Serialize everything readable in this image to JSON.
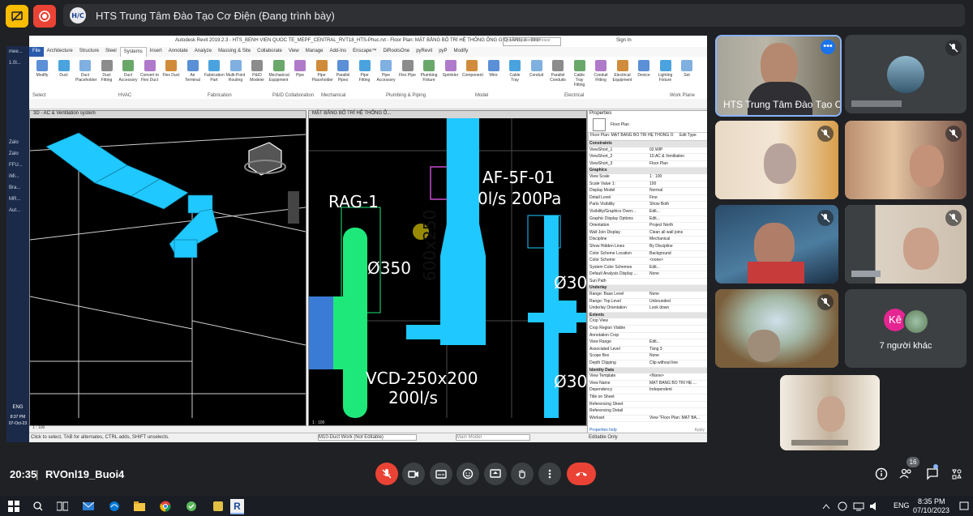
{
  "app": {
    "presenter_title": "HTS Trung Tâm Đào Tạo Cơ Điện (Đang trình bày)",
    "logo_text": "H/C",
    "time": "20:35",
    "meeting_code": "RVOnl19_Buoi4",
    "people_count": "16",
    "others_label": "7 người khác",
    "others_avatar": "Kê",
    "presenter_name": "HTS Trung Tâm Đào Tạo Cơ Đ..."
  },
  "revit": {
    "title": "Autodesk Revit 2019.2.3 - HTS_BENH VIEN QUOC TE_MEPF_CENTRAL_RVT18_HTS-Phuc.rvt - Floor Plan: MẶT BẰNG BỐ TRÍ HỆ THỐNG ỐNG GIÓ TẦNG 3 - WIP",
    "search_placeholder": "Type a keyword or phrase",
    "sign_in": "Sign In",
    "tabs": [
      "File",
      "Architecture",
      "Structure",
      "Steel",
      "Systems",
      "Insert",
      "Annotate",
      "Analyze",
      "Massing & Site",
      "Collaborate",
      "View",
      "Manage",
      "Add-Ins",
      "Enscape™",
      "DiRootsOne",
      "pyRevit",
      "pyP",
      "Modify"
    ],
    "ribbon_items": [
      "Modify",
      "Duct",
      "Duct Placeholder",
      "Duct Fitting",
      "Duct Accessory",
      "Convert to Flex Duct",
      "Flex Duct",
      "Air Terminal",
      "Fabrication Part",
      "Multi-Point Routing",
      "P&ID Modeler",
      "Mechanical Equipment",
      "Pipe",
      "Pipe Placeholder",
      "Parallel Pipes",
      "Pipe Fitting",
      "Pipe Accessory",
      "Flex Pipe",
      "Plumbing Fixture",
      "Sprinkler",
      "Component",
      "Wire",
      "Cable Tray",
      "Conduit",
      "Parallel Conduits",
      "Cable Tray Fitting",
      "Conduit Fitting",
      "Electrical Equipment",
      "Device",
      "Lighting Fixture",
      "Set"
    ],
    "ribbon_groups": [
      "Select",
      "HVAC",
      "Fabrication",
      "P&ID Collaboration",
      "Mechanical",
      "Plumbing & Piping",
      "Model",
      "Electrical",
      "Work Plane"
    ],
    "view3d_title": "3D - AC & Ventilation system",
    "viewplan_title": "MẶT BẰNG BỐ TRÍ HỆ THỐNG Ố...",
    "scale1": "1 : 100",
    "scale2": "1 : 100",
    "status_text": "Click to select, TAB for alternates, CTRL adds, SHIFT unselects.",
    "workset": "M10-Duct Work (Not Editable)",
    "main_model": "Main Model",
    "editable_only": "Editable Only",
    "cad_labels": {
      "rag": "RAG-1",
      "d350": "Ø350",
      "af": "AF-5F-01",
      "flow1": "0l/s  200Pa",
      "dim": "600x250",
      "d30a": "Ø30",
      "d30b": "Ø30",
      "vcd": "VCD-250x200",
      "flow2": "200l/s"
    }
  },
  "properties": {
    "header": "Properties",
    "type": "Floor Plan",
    "selector": "Floor Plan: MẶT BẰNG BỐ TRÍ HỆ THỐNG Ố",
    "edit_type": "Edit Type",
    "help": "Properties help",
    "apply": "Apply",
    "rows": [
      {
        "s": "Constraints"
      },
      {
        "k": "ViewShort_1",
        "v": "02.WIP"
      },
      {
        "k": "ViewShort_2",
        "v": "10.AC & Ventilation"
      },
      {
        "k": "ViewShort_3",
        "v": "Floor Plan"
      },
      {
        "s": "Graphics"
      },
      {
        "k": "View Scale",
        "v": "1 : 100"
      },
      {
        "k": "Scale Value  1:",
        "v": "100"
      },
      {
        "k": "Display Model",
        "v": "Normal"
      },
      {
        "k": "Detail Level",
        "v": "Fine"
      },
      {
        "k": "Parts Visibility",
        "v": "Show Both"
      },
      {
        "k": "Visibility/Graphics Overr...",
        "v": "Edit..."
      },
      {
        "k": "Graphic Display Options",
        "v": "Edit..."
      },
      {
        "k": "Orientation",
        "v": "Project North"
      },
      {
        "k": "Wall Join Display",
        "v": "Clean all wall joins"
      },
      {
        "k": "Discipline",
        "v": "Mechanical"
      },
      {
        "k": "Show Hidden Lines",
        "v": "By Discipline"
      },
      {
        "k": "Color Scheme Location",
        "v": "Background"
      },
      {
        "k": "Color Scheme",
        "v": "<none>"
      },
      {
        "k": "System Color Schemes",
        "v": "Edit..."
      },
      {
        "k": "Default Analysis Display ...",
        "v": "None"
      },
      {
        "k": "Sun Path",
        "v": ""
      },
      {
        "s": "Underlay"
      },
      {
        "k": "Range: Base Level",
        "v": "None"
      },
      {
        "k": "Range: Top Level",
        "v": "Unbounded"
      },
      {
        "k": "Underlay Orientation",
        "v": "Look down"
      },
      {
        "s": "Extents"
      },
      {
        "k": "Crop View",
        "v": ""
      },
      {
        "k": "Crop Region Visible",
        "v": ""
      },
      {
        "k": "Annotation Crop",
        "v": ""
      },
      {
        "k": "View Range",
        "v": "Edit..."
      },
      {
        "k": "Associated Level",
        "v": "Tầng 3"
      },
      {
        "k": "Scope Box",
        "v": "None"
      },
      {
        "k": "Depth Clipping",
        "v": "Clip without line"
      },
      {
        "s": "Identity Data"
      },
      {
        "k": "View Template",
        "v": "<None>"
      },
      {
        "k": "View Name",
        "v": "MẶT BẰNG BỐ TRÍ HỆ ..."
      },
      {
        "k": "Dependency",
        "v": "Independent"
      },
      {
        "k": "Title on Sheet",
        "v": ""
      },
      {
        "k": "Referencing Sheet",
        "v": ""
      },
      {
        "k": "Referencing Detail",
        "v": ""
      },
      {
        "k": "Workset",
        "v": "View \"Floor Plan: MẶT BẰ..."
      }
    ]
  },
  "win_strip": [
    "mee...",
    "1.0l...",
    "",
    "",
    "",
    "",
    "",
    "",
    "Zalo",
    "Zalo",
    "FFU...",
    "iMi...",
    "Bra...",
    "MR...",
    "Aut..."
  ],
  "win_strip_bottom": {
    "lang": "ENG",
    "time": "8:37 PM",
    "date": "07-Oct-23"
  },
  "taskbar": {
    "time": "8:35 PM",
    "date": "07/10/2023",
    "lang": "ENG"
  },
  "colors": {
    "duct": "#1fc8ff",
    "green": "#1ee87a",
    "danger": "#ea4335",
    "panel": "#3c4043"
  }
}
